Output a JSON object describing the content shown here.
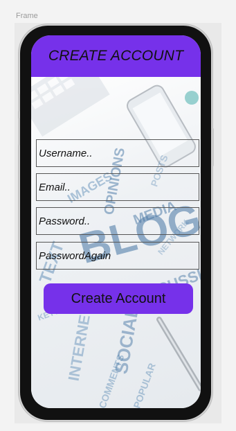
{
  "frame": {
    "label": "Frame"
  },
  "screen": {
    "title": "CREATE ACCOUNT",
    "fields": {
      "username": "Username..",
      "email": "Email..",
      "password": "Password..",
      "password_again": "PasswordAgain"
    },
    "submit_label": "Create Account"
  },
  "colors": {
    "accent": "#7631ea",
    "phone_body": "#111111"
  },
  "background_image": "blog word-cloud photo with keyboard, phone and pen"
}
